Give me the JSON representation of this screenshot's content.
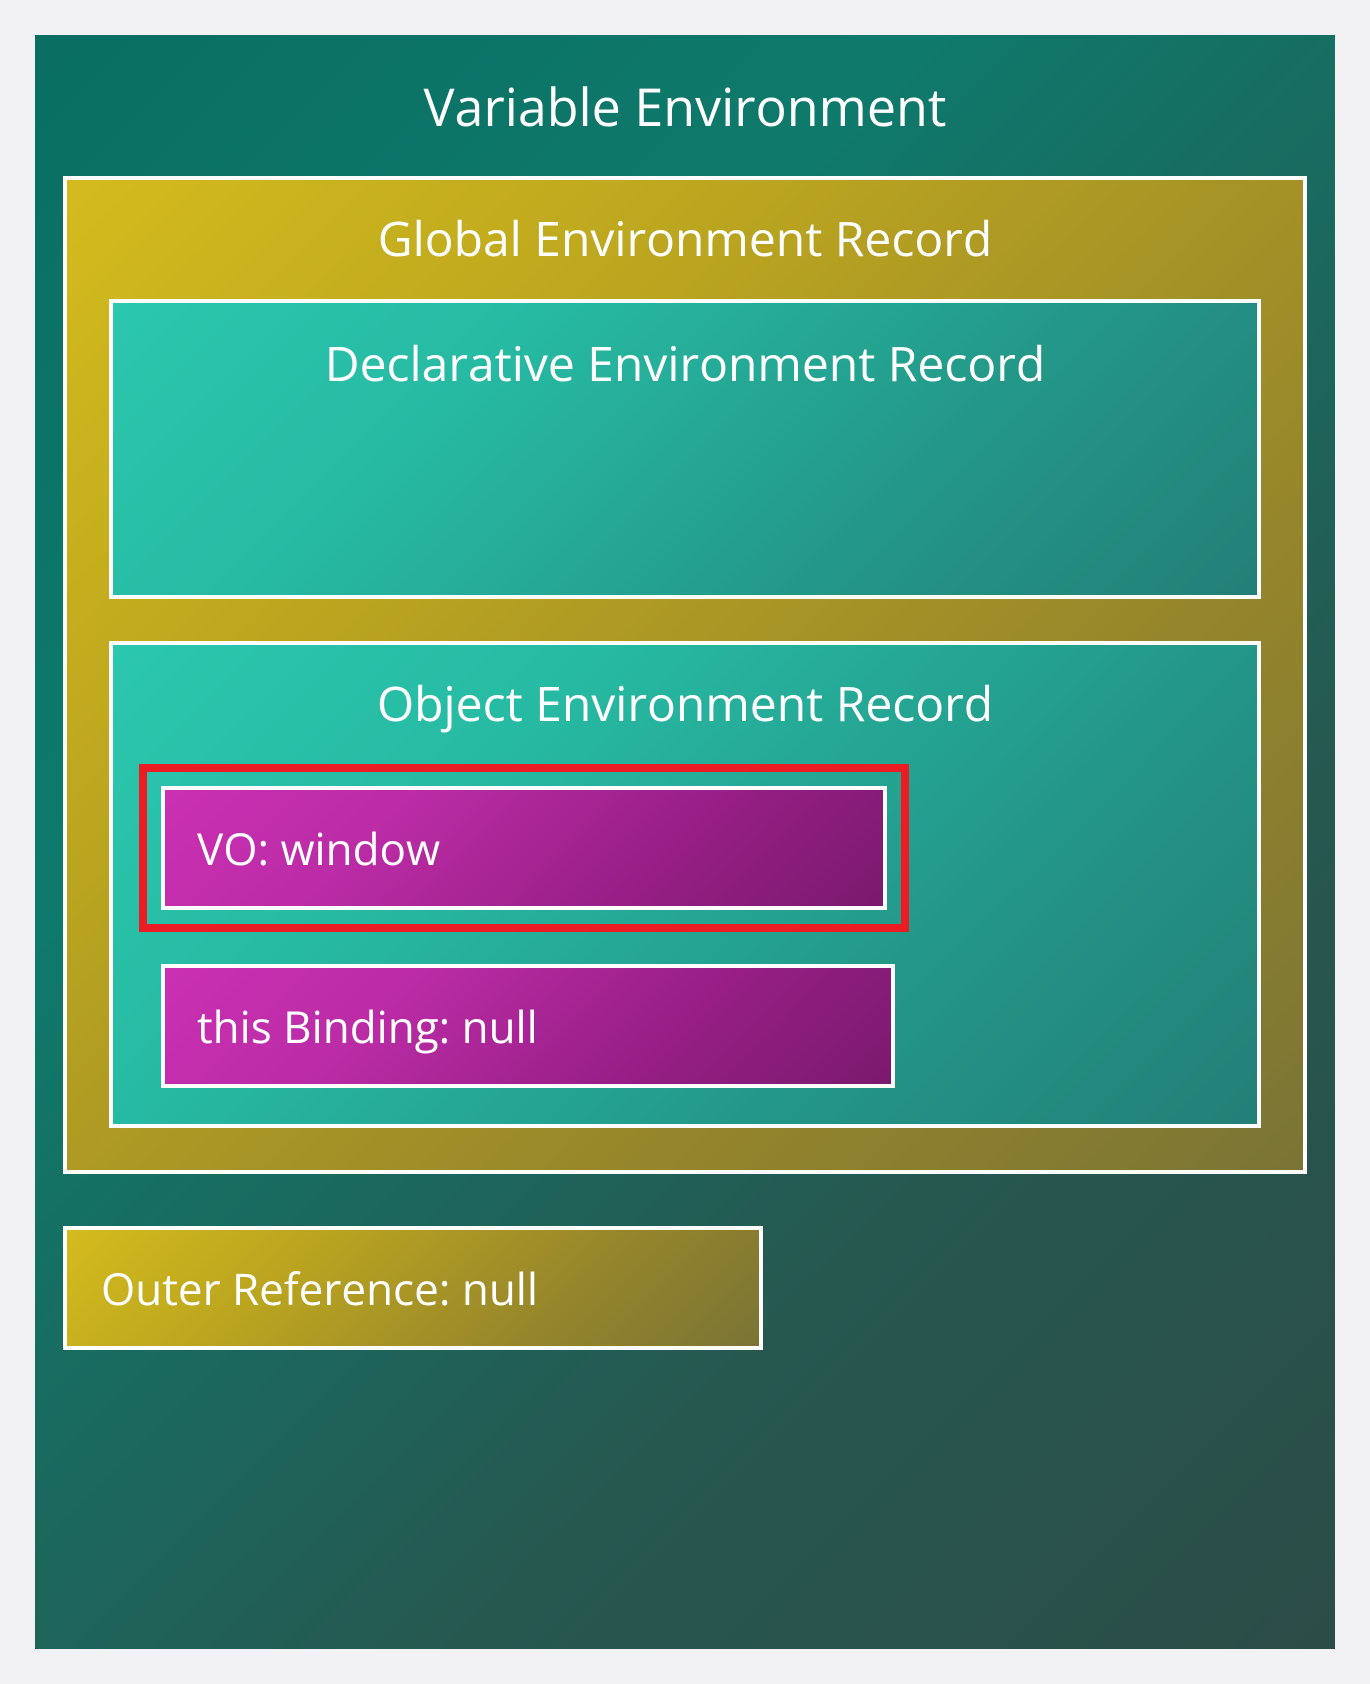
{
  "variableEnvironment": {
    "title": "Variable Environment",
    "globalRecord": {
      "title": "Global Environment Record",
      "declarativeRecord": {
        "title": "Declarative Environment Record"
      },
      "objectRecord": {
        "title": "Object Environment Record",
        "vo": "VO: window",
        "thisBinding": "this Binding: null"
      }
    },
    "outerReference": "Outer Reference: null"
  }
}
